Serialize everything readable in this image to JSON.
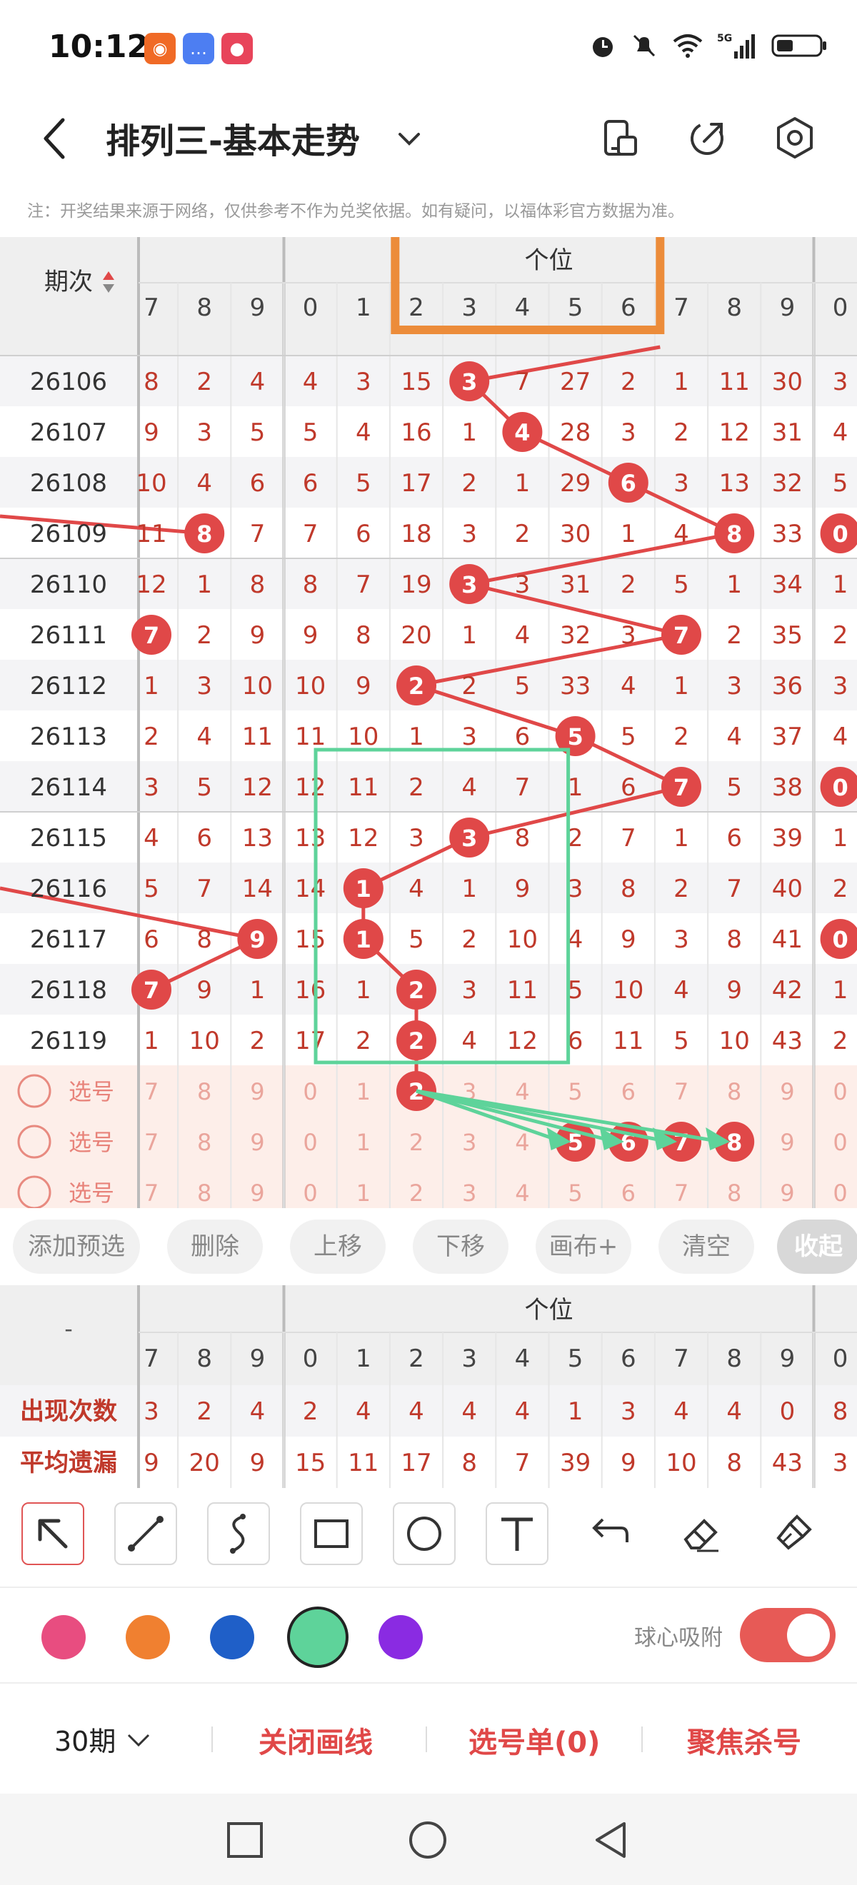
{
  "status": {
    "time": "10:12",
    "net": "5G",
    "sig": "6"
  },
  "header": {
    "title": "排列三-基本走势"
  },
  "note": "注：开奖结果来源于网络，仅供参考不作为兑奖依据。如有疑问，以福体彩官方数据为准。",
  "table": {
    "period_label": "期次",
    "group_label": "个位",
    "col_headers": [
      "7",
      "8",
      "9",
      "0",
      "1",
      "2",
      "3",
      "4",
      "5",
      "6",
      "7",
      "8",
      "9",
      "0"
    ],
    "rows": [
      {
        "p": "26106",
        "c": [
          "8",
          "2",
          "4",
          "4",
          "3",
          "15",
          "3",
          "7",
          "27",
          "2",
          "1",
          "11",
          "30",
          "3"
        ],
        "hit": [
          6
        ]
      },
      {
        "p": "26107",
        "c": [
          "9",
          "3",
          "5",
          "5",
          "4",
          "16",
          "1",
          "4",
          "28",
          "3",
          "2",
          "12",
          "31",
          "4"
        ],
        "hit": [
          7
        ]
      },
      {
        "p": "26108",
        "c": [
          "10",
          "4",
          "6",
          "6",
          "5",
          "17",
          "2",
          "1",
          "29",
          "6",
          "3",
          "13",
          "32",
          "5"
        ],
        "hit": [
          9
        ]
      },
      {
        "p": "26109",
        "c": [
          "11",
          "8",
          "7",
          "7",
          "6",
          "18",
          "3",
          "2",
          "30",
          "1",
          "4",
          "8",
          "33",
          "0"
        ],
        "hit": [
          1,
          11,
          13
        ]
      },
      {
        "p": "26110",
        "c": [
          "12",
          "1",
          "8",
          "8",
          "7",
          "19",
          "3",
          "3",
          "31",
          "2",
          "5",
          "1",
          "34",
          "1"
        ],
        "hit": [
          6
        ]
      },
      {
        "p": "26111",
        "c": [
          "7",
          "2",
          "9",
          "9",
          "8",
          "20",
          "1",
          "4",
          "32",
          "3",
          "7",
          "2",
          "35",
          "2"
        ],
        "hit": [
          0,
          10
        ]
      },
      {
        "p": "26112",
        "c": [
          "1",
          "3",
          "10",
          "10",
          "9",
          "2",
          "2",
          "5",
          "33",
          "4",
          "1",
          "3",
          "36",
          "3"
        ],
        "hit": [
          5
        ]
      },
      {
        "p": "26113",
        "c": [
          "2",
          "4",
          "11",
          "11",
          "10",
          "1",
          "3",
          "6",
          "5",
          "5",
          "2",
          "4",
          "37",
          "4"
        ],
        "hit": [
          8
        ]
      },
      {
        "p": "26114",
        "c": [
          "3",
          "5",
          "12",
          "12",
          "11",
          "2",
          "4",
          "7",
          "1",
          "6",
          "7",
          "5",
          "38",
          "0"
        ],
        "hit": [
          10,
          13
        ]
      },
      {
        "p": "26115",
        "c": [
          "4",
          "6",
          "13",
          "13",
          "12",
          "3",
          "3",
          "8",
          "2",
          "7",
          "1",
          "6",
          "39",
          "1"
        ],
        "hit": [
          6
        ]
      },
      {
        "p": "26116",
        "c": [
          "5",
          "7",
          "14",
          "14",
          "1",
          "4",
          "1",
          "9",
          "3",
          "8",
          "2",
          "7",
          "40",
          "2"
        ],
        "hit": [
          4
        ]
      },
      {
        "p": "26117",
        "c": [
          "6",
          "8",
          "9",
          "15",
          "1",
          "5",
          "2",
          "10",
          "4",
          "9",
          "3",
          "8",
          "41",
          "0"
        ],
        "hit": [
          2,
          4,
          13
        ]
      },
      {
        "p": "26118",
        "c": [
          "7",
          "9",
          "1",
          "16",
          "1",
          "2",
          "3",
          "11",
          "5",
          "10",
          "4",
          "9",
          "42",
          "1"
        ],
        "hit": [
          0,
          5
        ]
      },
      {
        "p": "26119",
        "c": [
          "1",
          "10",
          "2",
          "17",
          "2",
          "2",
          "4",
          "12",
          "6",
          "11",
          "5",
          "10",
          "43",
          "2"
        ],
        "hit": [
          5
        ]
      }
    ],
    "select_label": "选号",
    "select_rows": [
      {
        "c": [
          "7",
          "8",
          "9",
          "0",
          "1",
          "2",
          "3",
          "4",
          "5",
          "6",
          "7",
          "8",
          "9",
          "0"
        ],
        "hit": [
          5
        ]
      },
      {
        "c": [
          "7",
          "8",
          "9",
          "0",
          "1",
          "2",
          "3",
          "4",
          "5",
          "6",
          "7",
          "8",
          "9",
          "0"
        ],
        "hit": [
          8,
          9,
          10,
          11
        ]
      },
      {
        "c": [
          "7",
          "8",
          "9",
          "0",
          "1",
          "2",
          "3",
          "4",
          "5",
          "6",
          "7",
          "8",
          "9",
          "0"
        ],
        "hit": []
      }
    ]
  },
  "buttons": [
    "添加预选",
    "删除",
    "上移",
    "下移",
    "画布+",
    "清空",
    "收起"
  ],
  "stats": {
    "dash": "-",
    "group_label": "个位",
    "col_headers": [
      "7",
      "8",
      "9",
      "0",
      "1",
      "2",
      "3",
      "4",
      "5",
      "6",
      "7",
      "8",
      "9",
      "0"
    ],
    "rows": [
      {
        "label": "出现次数",
        "c": [
          "3",
          "2",
          "4",
          "2",
          "4",
          "4",
          "4",
          "4",
          "1",
          "3",
          "4",
          "4",
          "0",
          "8"
        ]
      },
      {
        "label": "平均遗漏",
        "c": [
          "9",
          "20",
          "9",
          "15",
          "11",
          "17",
          "8",
          "7",
          "39",
          "9",
          "10",
          "8",
          "43",
          "3"
        ]
      }
    ]
  },
  "colors": {
    "pink": "#e84d80",
    "orange": "#f08030",
    "blue": "#1f5fc8",
    "green": "#5ed39a",
    "purple": "#8a2be2",
    "accent_red": "#e04848"
  },
  "snap_label": "球心吸附",
  "snap_on": true,
  "bottom": {
    "period": "30期",
    "close_draw": "关闭画线",
    "select_list": "选号单(0)",
    "focus_kill": "聚焦杀号"
  }
}
